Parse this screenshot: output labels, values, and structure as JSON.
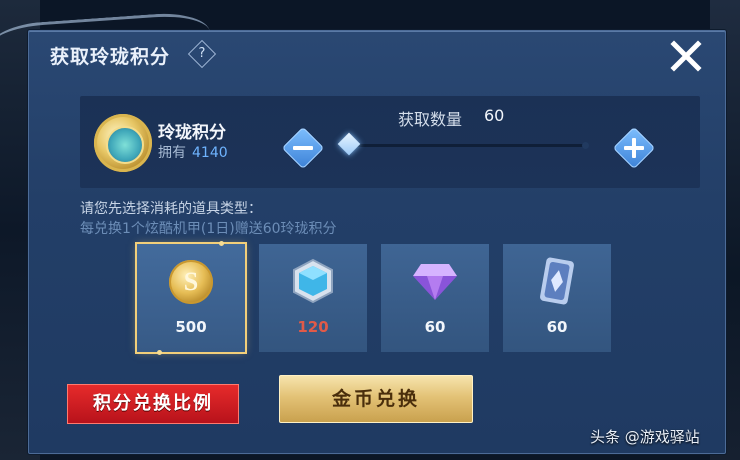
{
  "dialog": {
    "title": "获取玲珑积分",
    "help_symbol": "?",
    "close_icon": "close-icon"
  },
  "resource": {
    "name": "玲珑积分",
    "owned_label": "拥有",
    "owned_value": "4140",
    "icon": "linglong-coin-icon"
  },
  "quantity": {
    "label": "获取数量",
    "value": "60",
    "slider_fraction": 0.0
  },
  "prompt": {
    "main": "请您先选择消耗的道具类型：",
    "sub": "每兑换1个炫酷机甲(1日)赠送60玲珑积分"
  },
  "items": [
    {
      "icon": "gold-coin-s-icon",
      "value": "500",
      "selected": true,
      "symbol": "S"
    },
    {
      "icon": "blue-hex-gem-icon",
      "value": "120",
      "selected": false,
      "color": "#e05a48"
    },
    {
      "icon": "purple-diamond-icon",
      "value": "60",
      "selected": false
    },
    {
      "icon": "card-ticket-icon",
      "value": "60",
      "selected": false
    }
  ],
  "buttons": {
    "rate_label": "积分兑换比例",
    "gold_label": "金币兑换"
  },
  "watermark": "头条 @游戏驿站",
  "colors": {
    "dialog_bg": "#233f68",
    "accent_blue": "#6fb4ff",
    "gold": "#e3c276",
    "red": "#e62b2b",
    "selected_border": "#f2cf7a"
  }
}
